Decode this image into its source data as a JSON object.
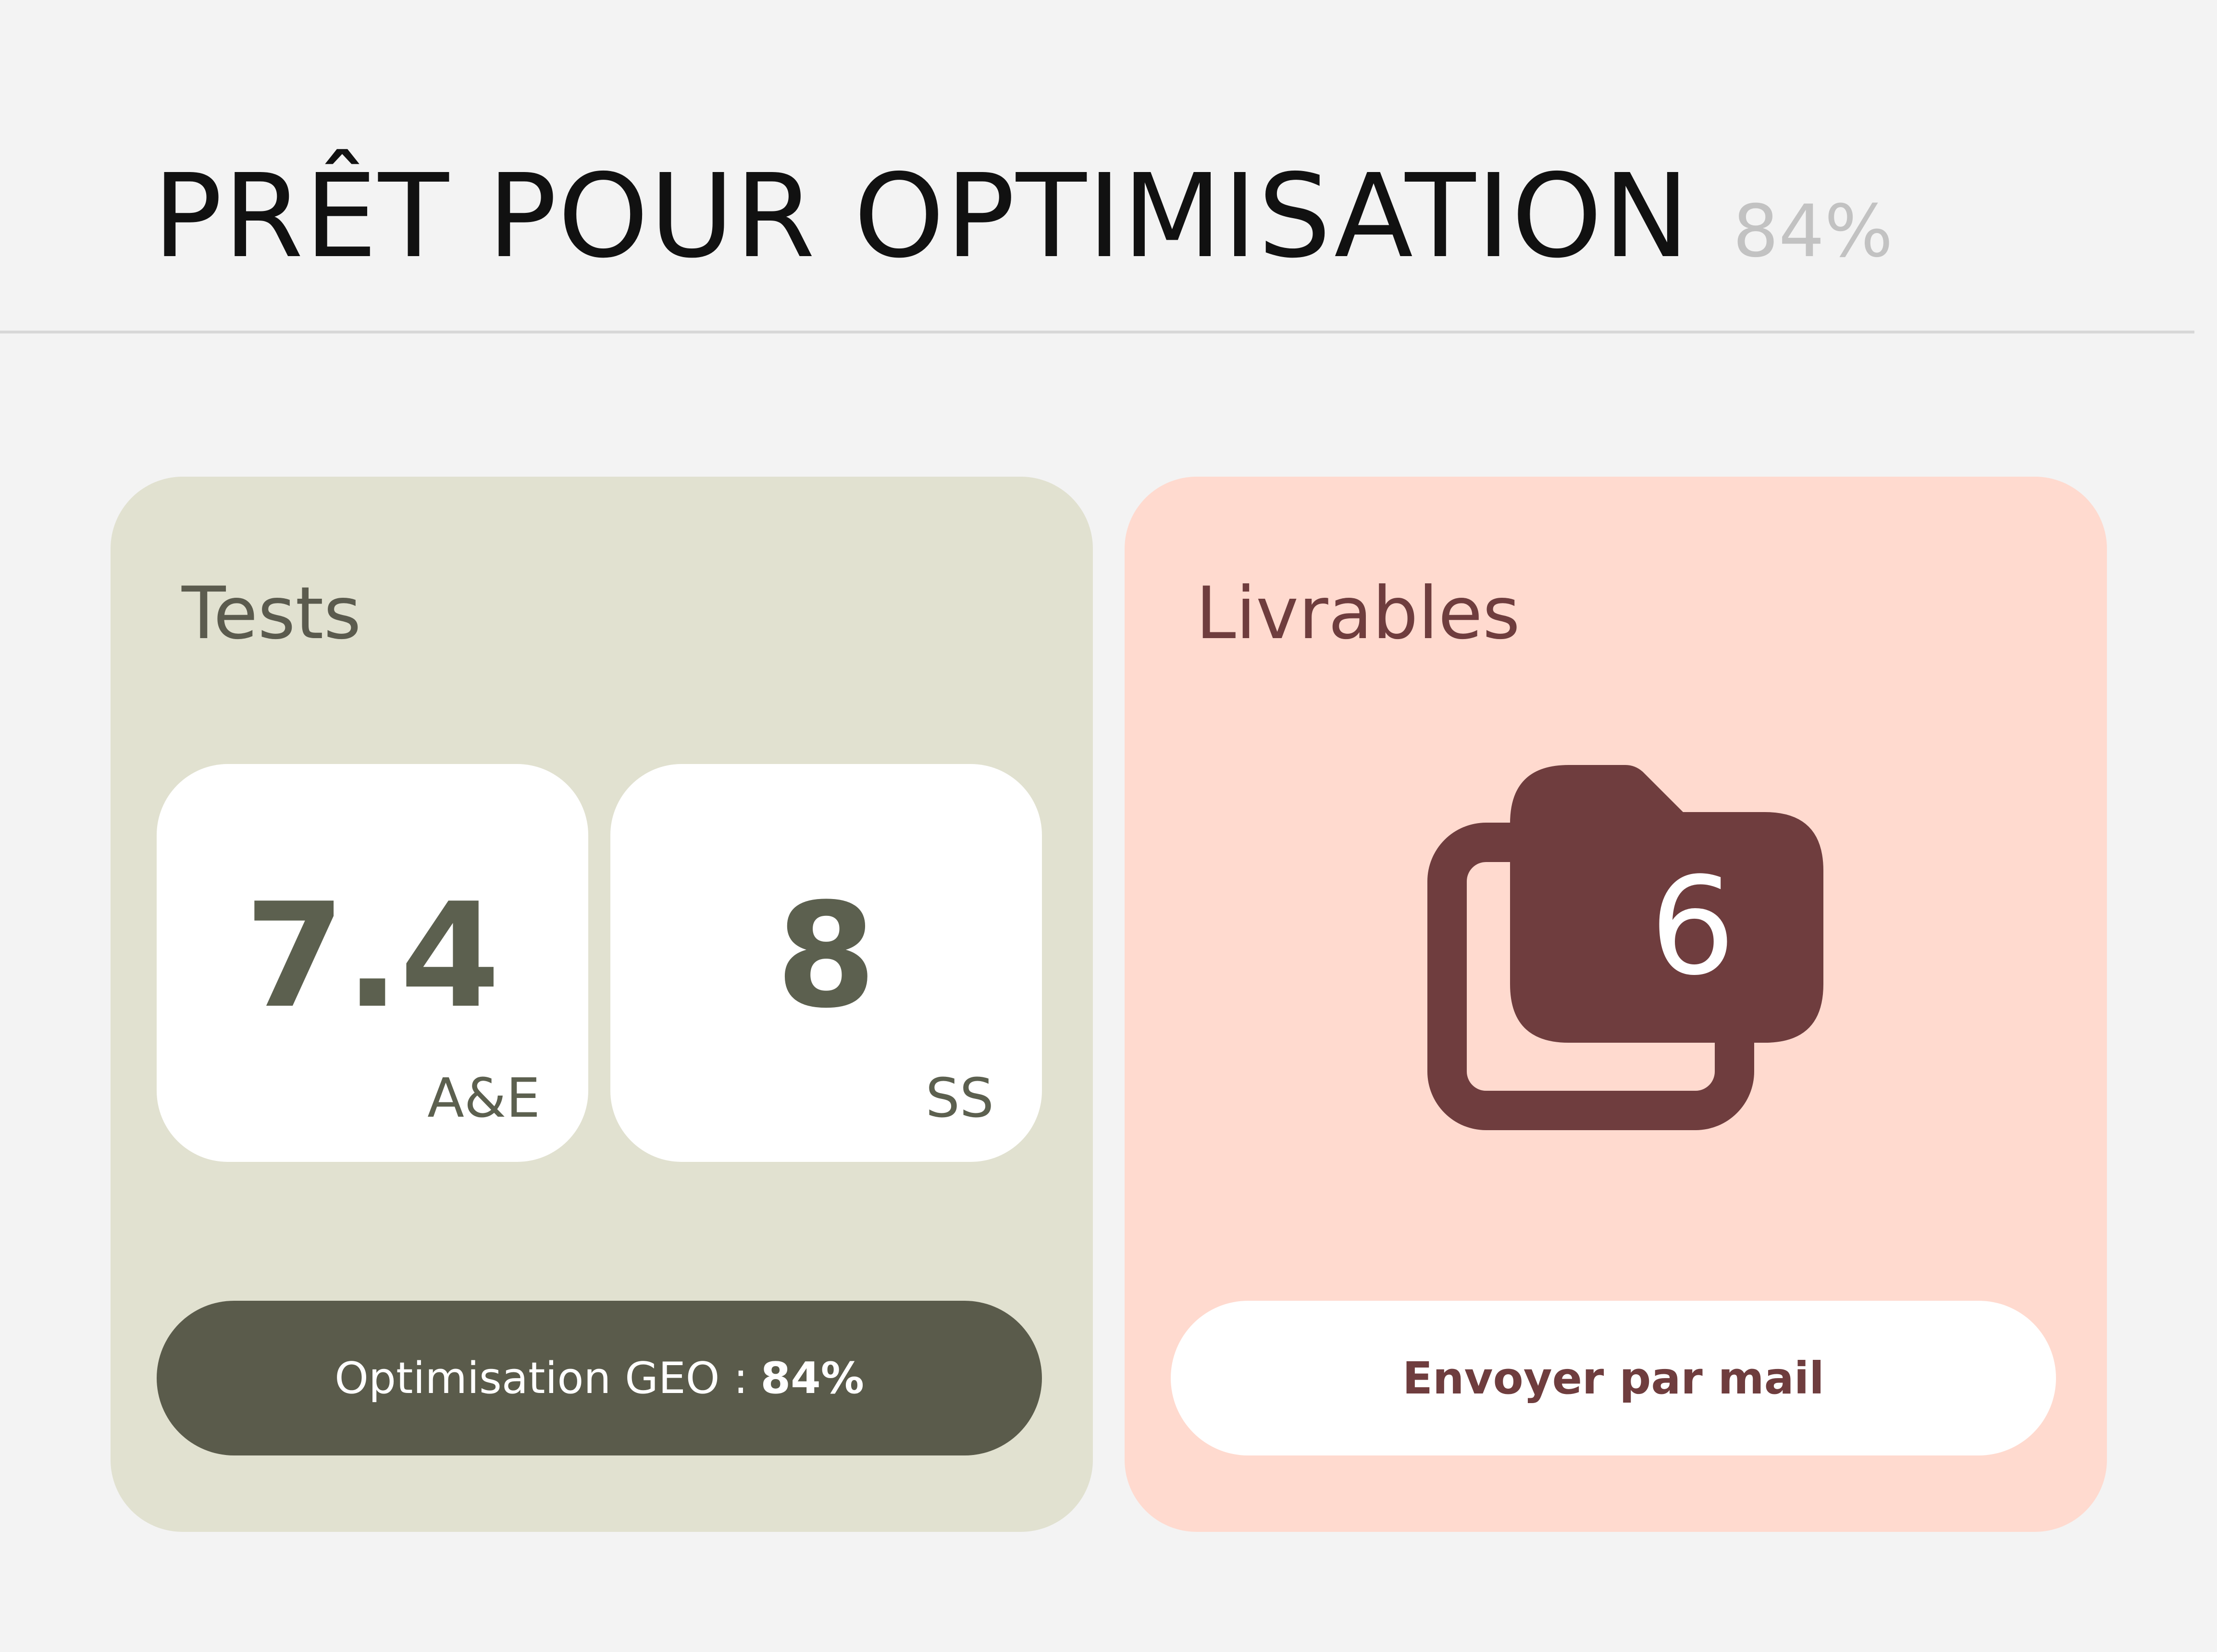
{
  "header": {
    "title": "PRÊT POUR OPTIMISATION",
    "percent": "84%"
  },
  "tests": {
    "title": "Tests",
    "stats": [
      {
        "value": "7.4",
        "label": "A&E"
      },
      {
        "value": "8",
        "label": "SS"
      }
    ],
    "geo_label": "Optimisation GEO :",
    "geo_value": "84%"
  },
  "livrables": {
    "title": "Livrables",
    "count": "6",
    "icon": "folders-icon",
    "send_label": "Envoyer par mail"
  },
  "colors": {
    "background": "#f3f3f3",
    "tests_card": "#e1e1d0",
    "tests_dark": "#5a5b4b",
    "livrables_card": "#ffdacf",
    "livrables_dark": "#6f3d3e"
  }
}
